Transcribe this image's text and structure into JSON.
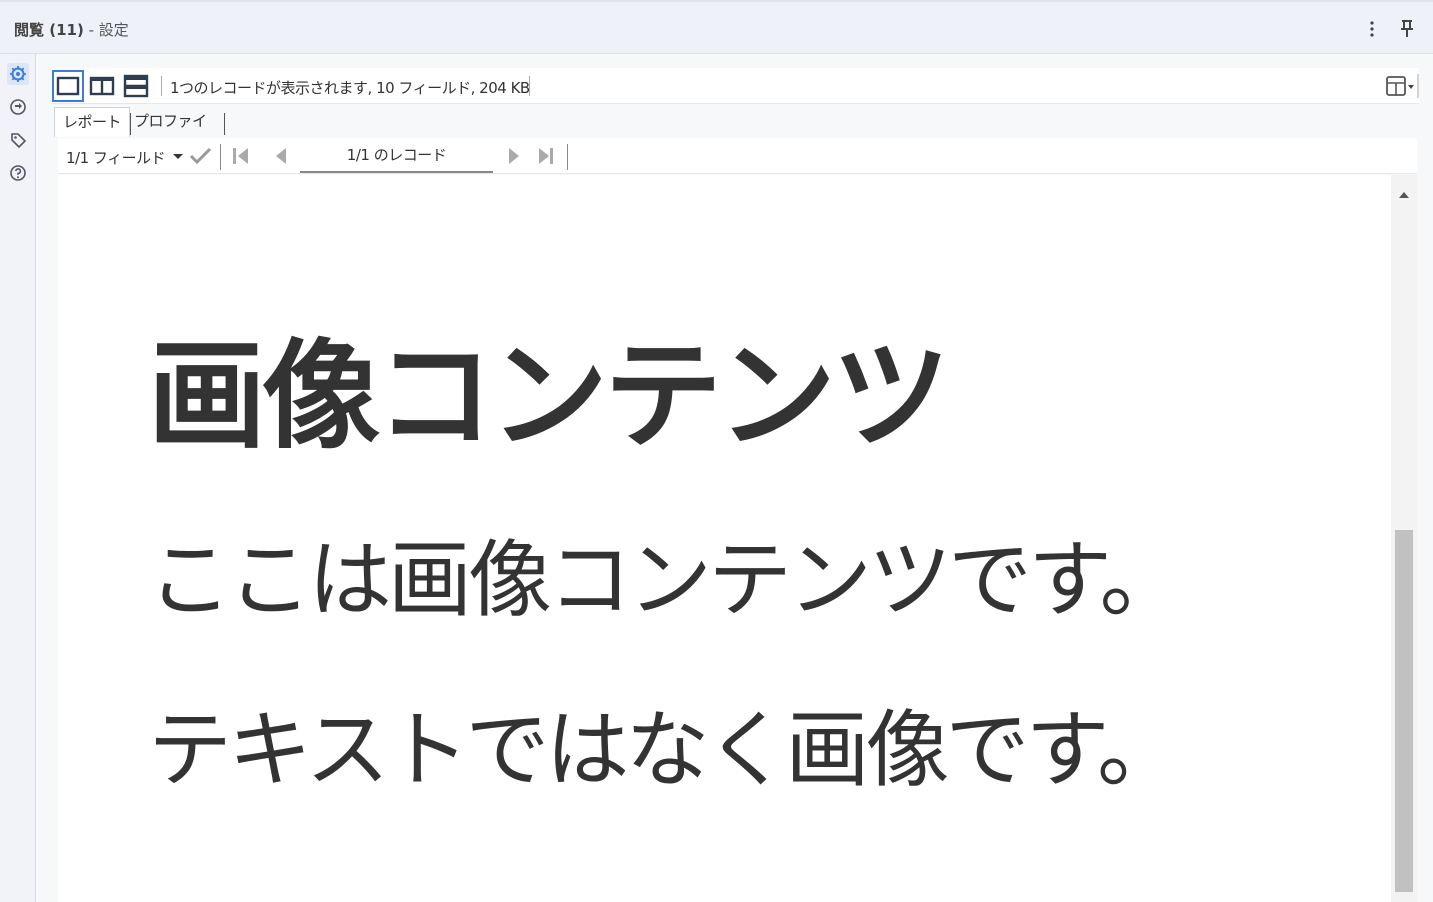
{
  "window": {
    "title": "閲覧 (11)",
    "title_suffix": " - 設定"
  },
  "toolbar": {
    "info": "1つのレコードが表示されます, 10 フィールド, 204 KB"
  },
  "tabs": [
    {
      "label": "レポート",
      "active": true
    },
    {
      "label": "プロファイル",
      "active": false
    }
  ],
  "navigation": {
    "field_selector": "1/1 フィールド",
    "record_indicator": "1/1 のレコード"
  },
  "image_content": {
    "heading": "画像コンテンツ",
    "line2": "ここは画像コンテンツです。",
    "line3": "テキストではなく画像です。"
  },
  "colors": {
    "accent": "#3b7ddd",
    "icon": "#3a4a5a",
    "text": "#333333"
  }
}
